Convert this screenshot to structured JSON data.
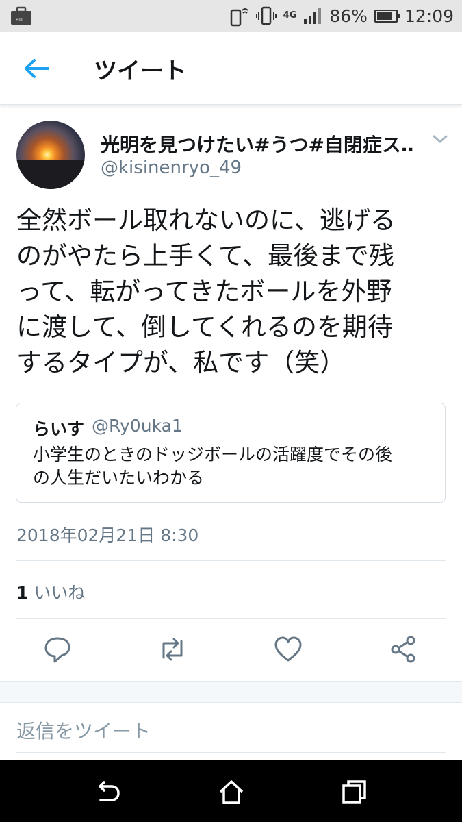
{
  "status_bar": {
    "battery": "86%",
    "time": "12:09",
    "network": "4G",
    "battery_level": 0.86
  },
  "header": {
    "title": "ツイート"
  },
  "tweet": {
    "author_name": "光明を見つけたい#うつ#自閉症ス…",
    "author_handle": "@kisinenryo_49",
    "text": "全然ボール取れないのに、逃げる\nのがやたら上手くて、最後まで残\nって、転がってきたボールを外野\nに渡して、倒してくれるのを期待\nするタイプが、私です（笑）",
    "quote": {
      "name": "らいす",
      "handle": "@Ry0uka1",
      "text": "小学生のときのドッジボールの活躍度でその後\nの人生だいたいわかる"
    },
    "timestamp": "2018年02月21日 8:30",
    "likes_count": "1",
    "likes_label": "いいね"
  },
  "actions": [
    "reply-icon",
    "retweet-icon",
    "like-icon",
    "share-icon"
  ],
  "reply_placeholder": "返信をツイート",
  "colors": {
    "accent": "#1da1f2",
    "text": "#14171a",
    "secondary": "#657786",
    "border": "#e1e8ed"
  }
}
